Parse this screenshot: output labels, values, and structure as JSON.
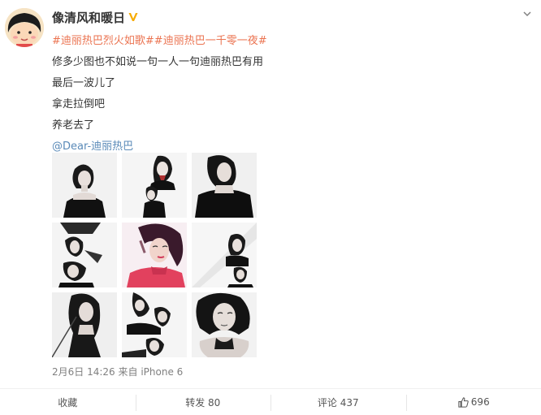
{
  "user": {
    "name": "像清风和暖日",
    "avatar_icon": "cartoon-girl-avatar",
    "verified_icon": "verified-v-icon",
    "verified_color": "#f7ab00"
  },
  "post": {
    "tag_1": "#迪丽热巴烈火如歌#",
    "tag_2": "#迪丽热巴一千零一夜#",
    "lines": [
      "修多少图也不如说一句一人一句迪丽热巴有用",
      "最后一波儿了",
      "拿走拉倒吧",
      "养老去了"
    ],
    "mention": "@Dear-迪丽热巴",
    "tag_color": "#eb7350",
    "mention_color": "#5a8ab8"
  },
  "photos": [
    {
      "name": "photo-1",
      "tone": "bw"
    },
    {
      "name": "photo-2",
      "tone": "bw"
    },
    {
      "name": "photo-3",
      "tone": "bw"
    },
    {
      "name": "photo-4",
      "tone": "bw"
    },
    {
      "name": "photo-5",
      "tone": "color"
    },
    {
      "name": "photo-6",
      "tone": "bw"
    },
    {
      "name": "photo-7",
      "tone": "bw"
    },
    {
      "name": "photo-8",
      "tone": "bw"
    },
    {
      "name": "photo-9",
      "tone": "bw"
    }
  ],
  "meta": {
    "timestamp": "2月6日 14:26",
    "source": "来自 iPhone 6"
  },
  "actions": {
    "collect": "收藏",
    "repost": "转发 80",
    "comment": "评论 437",
    "like": "696"
  }
}
